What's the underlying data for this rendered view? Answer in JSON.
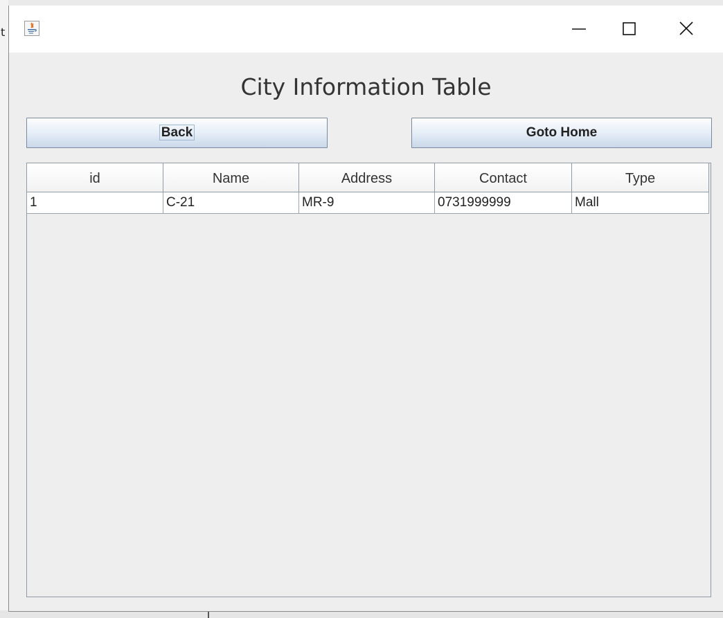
{
  "background": {
    "left_char": "t"
  },
  "window": {
    "title": "",
    "controls": {
      "minimize": "minimize-icon",
      "maximize": "maximize-icon",
      "close": "close-icon"
    }
  },
  "page": {
    "title": "City Information Table",
    "back_label": "Back",
    "home_label": "Goto Home"
  },
  "table": {
    "headers": [
      "id",
      "Name",
      "Address",
      "Contact",
      "Type"
    ],
    "rows": [
      [
        "1",
        "C-21",
        "MR-9",
        "0731999999",
        "Mall"
      ]
    ]
  },
  "colors": {
    "window_bg": "#eeeeee",
    "titlebar_bg": "#ffffff",
    "button_gradient_top": "#fdfeff",
    "button_gradient_bottom": "#c9d8e9"
  }
}
